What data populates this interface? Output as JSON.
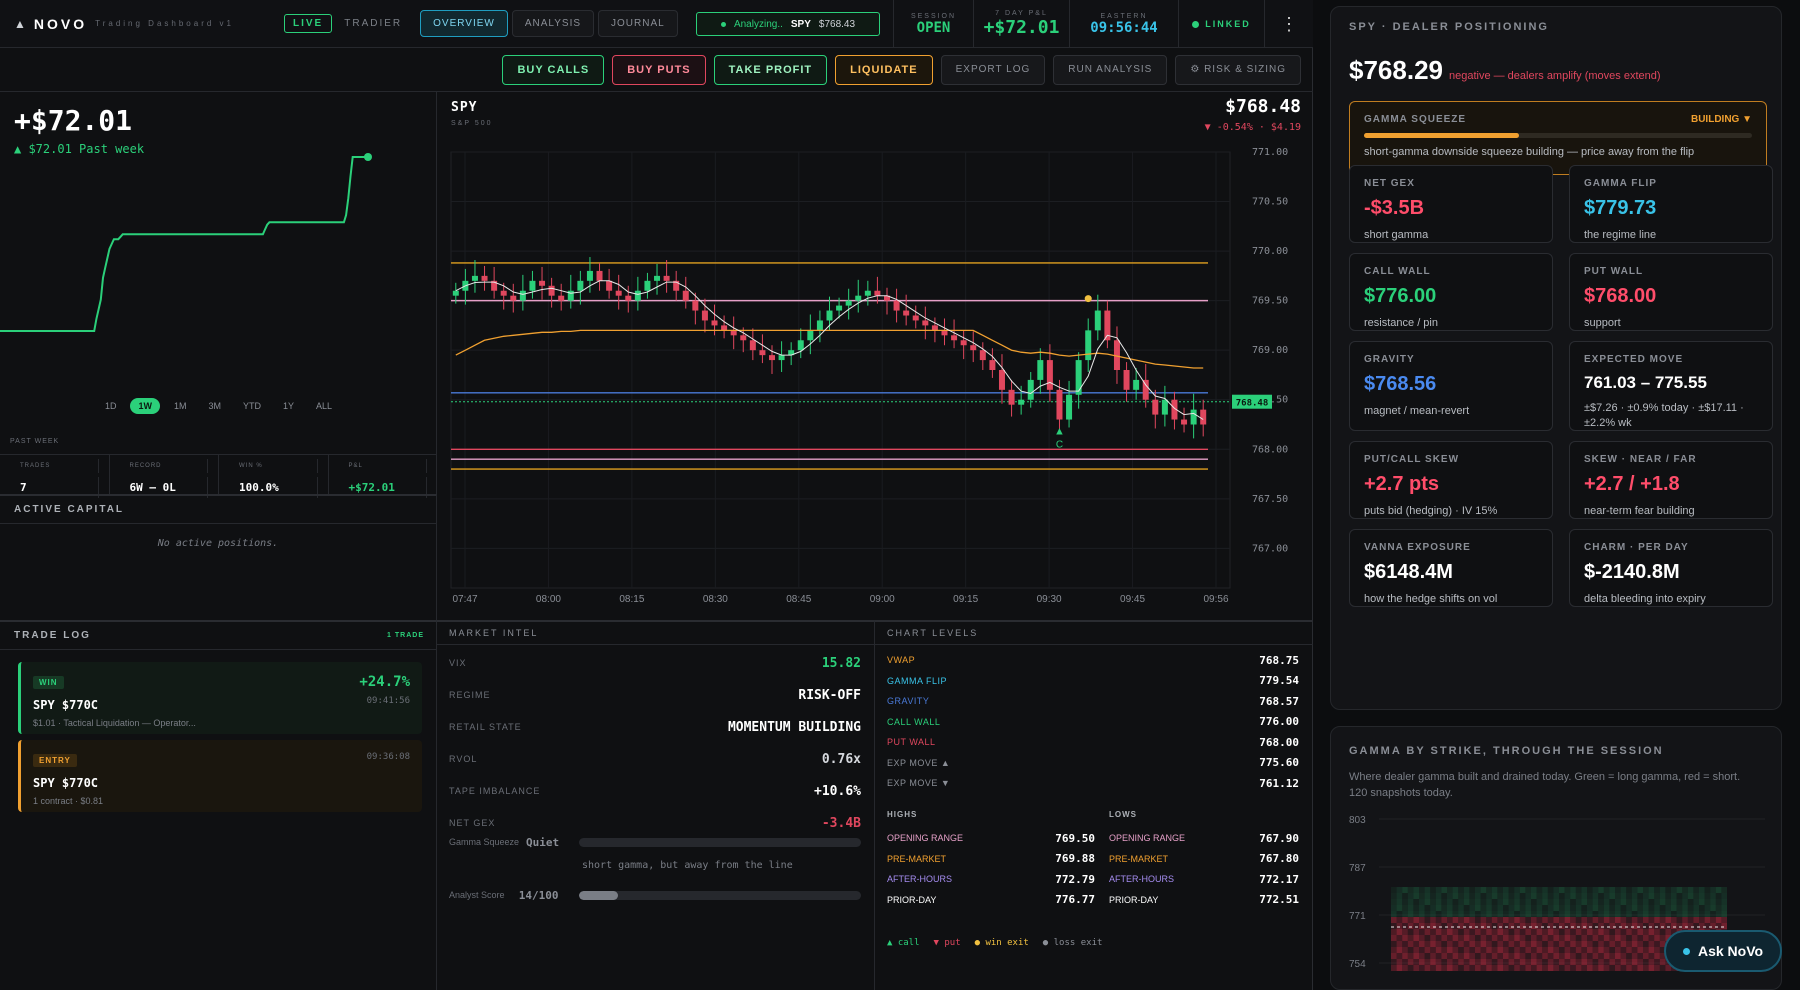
{
  "app": {
    "mark": "▲",
    "name": "NOVO",
    "subtitle": "Trading Dashboard v1",
    "live": "LIVE",
    "broker": "TRADIER"
  },
  "tabs": [
    {
      "label": "OVERVIEW",
      "active": true
    },
    {
      "label": "ANALYSIS"
    },
    {
      "label": "JOURNAL"
    }
  ],
  "analyzing": {
    "label": "Analyzing..",
    "symbol": "SPY",
    "price": "$768.43"
  },
  "header_stats": {
    "session": {
      "label": "SESSION",
      "value": "OPEN"
    },
    "pnl7": {
      "label": "7 DAY P&L",
      "value": "+$72.01"
    },
    "eastern": {
      "label": "EASTERN",
      "value": "09:56:44"
    },
    "linked": "LINKED",
    "menu": "⋮"
  },
  "actions": {
    "buy_calls": "BUY CALLS",
    "buy_puts": "BUY PUTS",
    "take_profit": "TAKE PROFIT",
    "liquidate": "LIQUIDATE",
    "export_log": "EXPORT LOG",
    "run_analysis": "RUN ANALYSIS",
    "risk_sizing": "⚙ RISK & SIZING"
  },
  "pnl": {
    "value": "+$72.01",
    "sub": "▲ $72.01 Past week",
    "ranges": [
      "1D",
      "1W",
      "1M",
      "3M",
      "YTD",
      "1Y",
      "ALL"
    ],
    "active_range": "1W",
    "period_label": "PAST WEEK",
    "stats": [
      {
        "label": "TRADES",
        "value": "7"
      },
      {
        "label": "RECORD",
        "value": "6W – 0L"
      },
      {
        "label": "WIN %",
        "value": "100.0%"
      },
      {
        "label": "P&L",
        "value": "+$72.01"
      }
    ],
    "curve": [
      0,
      0,
      0,
      0,
      0,
      0,
      0,
      0,
      0,
      0,
      0,
      0,
      0,
      0,
      0,
      0,
      0,
      0,
      0,
      0,
      0,
      0,
      0,
      0,
      0,
      0,
      0,
      0,
      0,
      0,
      0,
      0,
      0,
      0,
      0,
      0,
      0,
      0,
      0,
      0,
      0,
      0,
      0,
      0,
      5,
      9,
      13,
      22,
      26,
      30,
      34,
      36,
      38,
      38,
      38,
      39,
      40,
      40,
      40,
      40,
      40,
      40,
      40,
      40,
      40,
      40,
      40,
      40,
      40,
      40,
      40,
      40,
      40,
      40,
      40,
      40,
      40,
      40,
      40,
      40,
      40,
      40,
      40,
      40,
      40,
      40,
      40,
      40,
      40,
      40,
      40,
      40,
      40,
      40,
      40,
      40,
      40,
      40,
      40,
      40,
      40,
      40,
      40,
      40,
      40,
      40,
      40,
      40,
      40,
      40,
      40,
      40,
      40,
      40,
      40,
      40,
      40,
      40,
      40,
      40,
      40,
      42,
      44,
      45,
      45,
      45,
      45,
      45,
      45,
      45,
      45,
      45,
      45,
      45,
      45,
      45,
      45,
      45,
      45,
      45,
      45,
      45,
      45,
      45,
      45,
      45,
      45,
      45,
      45,
      45,
      45,
      45,
      45,
      45,
      45,
      45,
      45,
      45,
      48,
      55,
      64,
      72,
      72,
      72,
      72,
      72,
      72,
      72,
      72
    ]
  },
  "active_capital": {
    "title": "ACTIVE CAPITAL",
    "empty": "No active positions."
  },
  "chart": {
    "symbol": "SPY",
    "name": "S&P 500",
    "price": "$768.48",
    "change": "▼ -0.54% · $4.19",
    "price_tag": "768.48"
  },
  "chart_data": {
    "type": "candlestick",
    "y_ticks": [
      "771.00",
      "770.50",
      "770.00",
      "769.50",
      "769.00",
      "768.50",
      "768.00",
      "767.50",
      "767.00"
    ],
    "ylim": [
      766.6,
      771.0
    ],
    "x_ticks": [
      "07:47",
      "08:00",
      "08:15",
      "08:30",
      "08:45",
      "09:00",
      "09:15",
      "09:30",
      "09:45",
      "09:56"
    ],
    "levels": [
      {
        "value": 769.88,
        "color": "#e0a020"
      },
      {
        "value": 769.5,
        "color": "#e6a0c8"
      },
      {
        "value": 768.57,
        "color": "#4a7ad8"
      },
      {
        "value": 768.0,
        "color": "#e0475e"
      },
      {
        "value": 767.9,
        "color": "#e6a0c8"
      },
      {
        "value": 767.8,
        "color": "#e0a020"
      }
    ],
    "closes": [
      769.6,
      769.7,
      769.75,
      769.7,
      769.6,
      769.55,
      769.5,
      769.6,
      769.7,
      769.65,
      769.55,
      769.5,
      769.6,
      769.7,
      769.8,
      769.7,
      769.6,
      769.55,
      769.5,
      769.6,
      769.7,
      769.75,
      769.7,
      769.6,
      769.5,
      769.4,
      769.3,
      769.25,
      769.2,
      769.15,
      769.1,
      769.0,
      768.95,
      768.9,
      768.95,
      769.0,
      769.1,
      769.2,
      769.3,
      769.4,
      769.45,
      769.5,
      769.55,
      769.6,
      769.55,
      769.5,
      769.4,
      769.35,
      769.3,
      769.25,
      769.2,
      769.15,
      769.1,
      769.05,
      769.0,
      768.9,
      768.8,
      768.6,
      768.45,
      768.5,
      768.7,
      768.9,
      768.6,
      768.3,
      768.55,
      768.9,
      769.2,
      769.4,
      769.1,
      768.8,
      768.6,
      768.7,
      768.5,
      768.35,
      768.5,
      768.3,
      768.25,
      768.4,
      768.25
    ],
    "vwap": [
      768.95,
      769.0,
      769.05,
      769.1,
      769.12,
      769.14,
      769.15,
      769.16,
      769.17,
      769.18,
      769.18,
      769.19,
      769.19,
      769.2,
      769.2,
      769.2,
      769.2,
      769.2,
      769.2,
      769.2,
      769.2,
      769.2,
      769.2,
      769.2,
      769.2,
      769.2,
      769.2,
      769.2,
      769.2,
      769.2,
      769.2,
      769.2,
      769.2,
      769.2,
      769.2,
      769.2,
      769.2,
      769.2,
      769.2,
      769.2,
      769.2,
      769.2,
      769.2,
      769.2,
      769.2,
      769.2,
      769.2,
      769.2,
      769.2,
      769.2,
      769.2,
      769.2,
      769.2,
      769.2,
      769.2,
      769.15,
      769.1,
      769.05,
      769.0,
      768.98,
      768.97,
      768.98,
      768.97,
      768.95,
      768.94,
      768.95,
      768.96,
      768.97,
      768.96,
      768.94,
      768.92,
      768.9,
      768.88,
      768.86,
      768.85,
      768.84,
      768.83,
      768.82,
      768.82
    ],
    "markers": [
      {
        "label": "C",
        "type": "call"
      }
    ]
  },
  "trade_log": {
    "title": "TRADE LOG",
    "count": "1 TRADE",
    "items": [
      {
        "chip": "WIN",
        "pct": "+24.7%",
        "time": "09:41:56",
        "ticker": "SPY $770C",
        "desc": "$1.01 · Tactical Liquidation — Operator..."
      },
      {
        "chip": "ENTRY",
        "time": "09:36:08",
        "ticker": "SPY $770C",
        "desc": "1 contract · $0.81"
      }
    ]
  },
  "intel": {
    "title": "MARKET INTEL",
    "rows": [
      {
        "k": "VIX",
        "v": "15.82",
        "color": "#2bd07a"
      },
      {
        "k": "REGIME",
        "v": "RISK-OFF",
        "color": "#ffffff"
      },
      {
        "k": "RETAIL STATE",
        "v": "MOMENTUM BUILDING",
        "color": "#ffffff"
      },
      {
        "k": "RVOL",
        "v": "0.76x",
        "color": "#d6d9de"
      },
      {
        "k": "TAPE IMBALANCE",
        "v": "+10.6%",
        "color": "#ffffff"
      },
      {
        "k": "NET GEX",
        "v": "-3.4B",
        "color": "#e0475e"
      }
    ],
    "squeeze": {
      "label": "Gamma Squeeze",
      "state": "Quiet",
      "note": "short gamma, but away from the line",
      "level": 0.0
    },
    "analyst": {
      "label": "Analyst Score",
      "value": "14/100",
      "level": 0.14
    }
  },
  "levels": {
    "title": "CHART LEVELS",
    "rows": [
      {
        "k": "VWAP",
        "v": "768.75",
        "color": "#f0a030"
      },
      {
        "k": "GAMMA FLIP",
        "v": "779.54",
        "color": "#39c3e8"
      },
      {
        "k": "GRAVITY",
        "v": "768.57",
        "color": "#4a7ad8"
      },
      {
        "k": "CALL WALL",
        "v": "776.00",
        "color": "#2bd07a"
      },
      {
        "k": "PUT WALL",
        "v": "768.00",
        "color": "#e0475e"
      },
      {
        "k": "EXP MOVE ▲",
        "v": "775.60",
        "color": "#8a8e96"
      },
      {
        "k": "EXP MOVE ▼",
        "v": "761.12",
        "color": "#8a8e96"
      }
    ],
    "highs_title": "HIGHS",
    "lows_title": "LOWS",
    "highs": [
      {
        "k": "OPENING RANGE",
        "v": "769.50",
        "color": "#e6a0c8"
      },
      {
        "k": "PRE-MARKET",
        "v": "769.88",
        "color": "#f0a030"
      },
      {
        "k": "AFTER-HOURS",
        "v": "772.79",
        "color": "#a58cf0"
      },
      {
        "k": "PRIOR-DAY",
        "v": "776.77",
        "color": "#ffffff"
      }
    ],
    "lows": [
      {
        "k": "OPENING RANGE",
        "v": "767.90",
        "color": "#e6a0c8"
      },
      {
        "k": "PRE-MARKET",
        "v": "767.80",
        "color": "#f0a030"
      },
      {
        "k": "AFTER-HOURS",
        "v": "772.17",
        "color": "#a58cf0"
      },
      {
        "k": "PRIOR-DAY",
        "v": "772.51",
        "color": "#ffffff"
      }
    ],
    "legend": [
      {
        "t": "▲ call",
        "c": "#2bd07a"
      },
      {
        "t": "▼ put",
        "c": "#e0475e"
      },
      {
        "t": "● win exit",
        "c": "#f0c040"
      },
      {
        "t": "● loss exit",
        "c": "#8a8e96"
      }
    ]
  },
  "dealer": {
    "title": "SPY · DEALER POSITIONING",
    "price": "$768.29",
    "note": "negative — dealers amplify (moves extend)",
    "squeeze": {
      "label": "GAMMA SQUEEZE",
      "state": "BUILDING ▼",
      "level": 0.4,
      "text": "short-gamma downside squeeze building — price away from the flip"
    },
    "cards": [
      {
        "l": "NET GEX",
        "v": "-$3.5B",
        "d": "short gamma",
        "c": "#ff4d6a"
      },
      {
        "l": "GAMMA FLIP",
        "v": "$779.73",
        "d": "the regime line",
        "c": "#39c3e8"
      },
      {
        "l": "CALL WALL",
        "v": "$776.00",
        "d": "resistance / pin",
        "c": "#2bd07a"
      },
      {
        "l": "PUT WALL",
        "v": "$768.00",
        "d": "support",
        "c": "#ff4d6a"
      },
      {
        "l": "GRAVITY",
        "v": "$768.56",
        "d": "magnet / mean-revert",
        "c": "#4a8af0"
      },
      {
        "l": "EXPECTED MOVE",
        "v": "761.03 – 775.55",
        "d": "±$7.26 · ±0.9% today · ±$17.11 · ±2.2% wk",
        "c": "#ffffff"
      },
      {
        "l": "PUT/CALL SKEW",
        "v": "+2.7 pts",
        "d": "puts bid (hedging) · IV 15%",
        "c": "#ff4d6a"
      },
      {
        "l": "SKEW · NEAR / FAR",
        "v": "+2.7 / +1.8",
        "d": "near-term fear building",
        "c": "#ff4d6a"
      },
      {
        "l": "VANNA EXPOSURE",
        "v": "$6148.4M",
        "d": "how the hedge shifts on vol",
        "c": "#ffffff"
      },
      {
        "l": "CHARM · PER DAY",
        "v": "$-2140.8M",
        "d": "delta bleeding into expiry",
        "c": "#ffffff"
      }
    ]
  },
  "gamma_panel": {
    "title": "GAMMA BY STRIKE, THROUGH THE SESSION",
    "desc": "Where dealer gamma built and drained today. Green = long gamma, red = short. 120 snapshots today.",
    "y_ticks": [
      "803",
      "787",
      "771",
      "754"
    ]
  },
  "ask": {
    "label": "Ask NoVo"
  }
}
